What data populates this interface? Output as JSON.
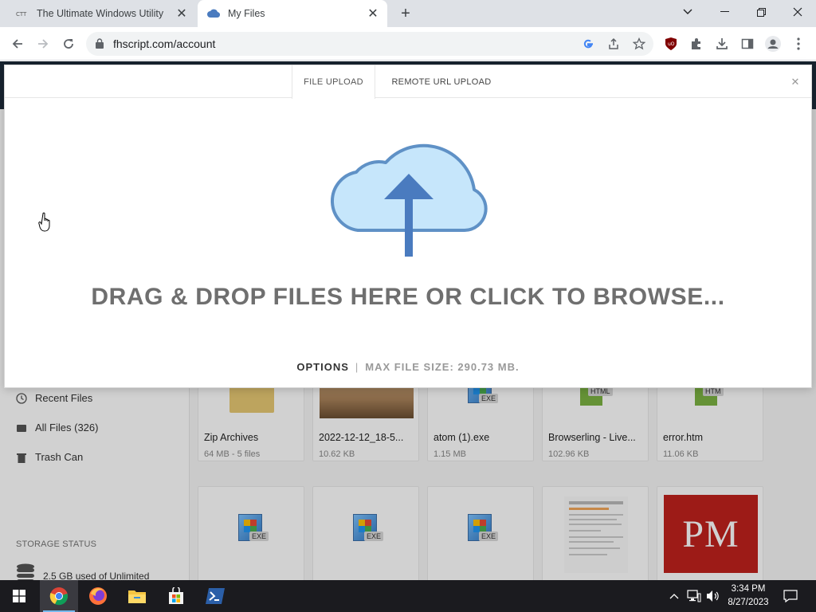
{
  "browser": {
    "tabs": [
      {
        "title": "The Ultimate Windows Utility",
        "favicon": "ctt-icon",
        "active": false
      },
      {
        "title": "My Files",
        "favicon": "cloud-icon",
        "active": true
      }
    ],
    "url": "fhscript.com/account"
  },
  "sidebar": {
    "items": [
      {
        "label": "Recent Files",
        "icon": "clock-icon"
      },
      {
        "label": "All Files (326)",
        "icon": "stack-icon"
      },
      {
        "label": "Trash Can",
        "icon": "trash-icon"
      }
    ],
    "storage_title": "STORAGE STATUS",
    "storage_text": "2.5 GB used of Unlimited"
  },
  "files": [
    {
      "name": "Zip Archives",
      "meta": "64 MB - 5 files",
      "kind": "folder"
    },
    {
      "name": "2022-12-12_18-5...",
      "meta": "10.62 KB",
      "kind": "image"
    },
    {
      "name": "atom (1).exe",
      "meta": "1.15 MB",
      "kind": "exe",
      "tag": "EXE"
    },
    {
      "name": "Browserling - Live...",
      "meta": "102.96 KB",
      "kind": "html",
      "tag": "HTML"
    },
    {
      "name": "error.htm",
      "meta": "11.06 KB",
      "kind": "html",
      "tag": "HTM"
    },
    {
      "kind": "exe",
      "tag": "EXE"
    },
    {
      "kind": "exe",
      "tag": "EXE"
    },
    {
      "kind": "exe",
      "tag": "EXE"
    },
    {
      "kind": "document"
    },
    {
      "kind": "image",
      "thumb_text": "PM"
    }
  ],
  "modal": {
    "tabs": [
      "FILE UPLOAD",
      "REMOTE URL UPLOAD"
    ],
    "active_tab": "FILE UPLOAD",
    "drop_text": "DRAG & DROP FILES HERE OR CLICK TO BROWSE...",
    "options_label": "OPTIONS",
    "separator": "|",
    "max_size": "MAX FILE SIZE: 290.73 MB."
  },
  "taskbar": {
    "apps": [
      "windows-start-icon",
      "chrome-icon",
      "firefox-icon",
      "file-explorer-icon",
      "store-icon",
      "powershell-icon"
    ],
    "time": "3:34 PM",
    "date": "8/27/2023"
  },
  "colors": {
    "page_header": "#1d2b3a",
    "cloud_fill": "#c6e6fb",
    "cloud_stroke": "#5f91c6",
    "arrow": "#4a7bbf",
    "drop_text": "#6f6f6f",
    "taskbar": "#1b1b1f"
  }
}
